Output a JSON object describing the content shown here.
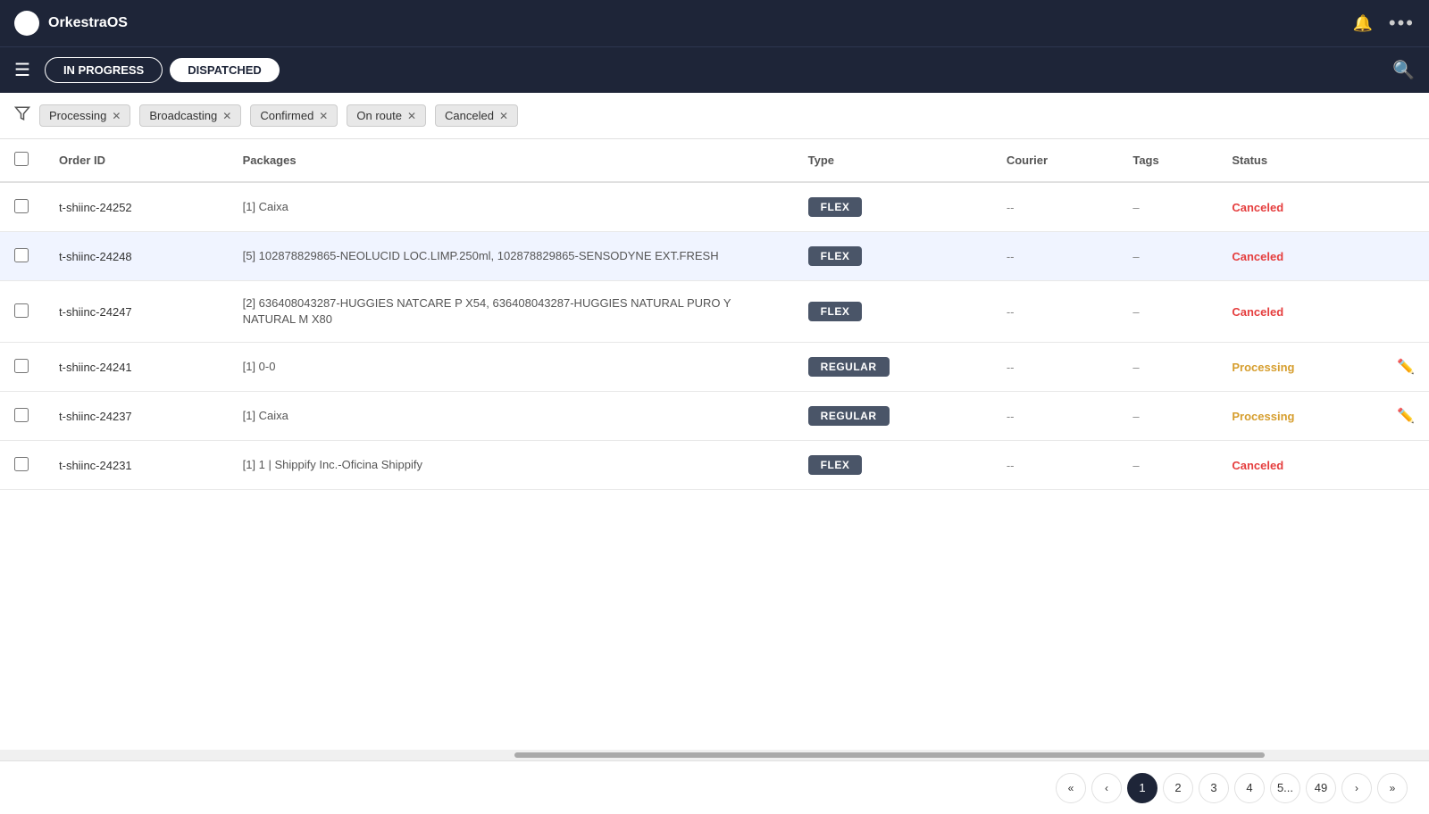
{
  "app": {
    "name": "OrkestraOS",
    "logo": "O"
  },
  "top_nav": {
    "bell_icon": "🔔",
    "more_icon": "···"
  },
  "sub_nav": {
    "tabs": [
      {
        "id": "in-progress",
        "label": "IN PROGRESS",
        "active": false
      },
      {
        "id": "dispatched",
        "label": "DISPATCHED",
        "active": true
      }
    ]
  },
  "filters": {
    "filter_icon": "▼",
    "tags": [
      {
        "id": "processing",
        "label": "Processing"
      },
      {
        "id": "broadcasting",
        "label": "Broadcasting"
      },
      {
        "id": "confirmed",
        "label": "Confirmed"
      },
      {
        "id": "on-route",
        "label": "On route"
      },
      {
        "id": "canceled",
        "label": "Canceled"
      }
    ]
  },
  "table": {
    "columns": [
      "Order ID",
      "Packages",
      "Type",
      "Courier",
      "Tags",
      "Status"
    ],
    "rows": [
      {
        "id": "t-shiinc-24252",
        "packages": "[1] Caixa",
        "type": "FLEX",
        "type_class": "flex",
        "courier": "--",
        "tags": "–",
        "status": "Canceled",
        "status_class": "status-canceled",
        "highlighted": false,
        "editable": false
      },
      {
        "id": "t-shiinc-24248",
        "packages": "[5] 102878829865-NEOLUCID LOC.LIMP.250ml, 102878829865-SENSODYNE EXT.FRESH",
        "type": "FLEX",
        "type_class": "flex",
        "courier": "--",
        "tags": "–",
        "status": "Canceled",
        "status_class": "status-canceled",
        "highlighted": true,
        "editable": false
      },
      {
        "id": "t-shiinc-24247",
        "packages": "[2] 636408043287-HUGGIES NATCARE P X54, 636408043287-HUGGIES NATURAL PURO Y NATURAL M X80",
        "type": "FLEX",
        "type_class": "flex",
        "courier": "--",
        "tags": "–",
        "status": "Canceled",
        "status_class": "status-canceled",
        "highlighted": false,
        "editable": false
      },
      {
        "id": "t-shiinc-24241",
        "packages": "[1] 0-0",
        "type": "REGULAR",
        "type_class": "regular",
        "courier": "--",
        "tags": "–",
        "status": "Processing",
        "status_class": "status-processing",
        "highlighted": false,
        "editable": true
      },
      {
        "id": "t-shiinc-24237",
        "packages": "[1] Caixa",
        "type": "REGULAR",
        "type_class": "regular",
        "courier": "--",
        "tags": "–",
        "status": "Processing",
        "status_class": "status-processing",
        "highlighted": false,
        "editable": true
      },
      {
        "id": "t-shiinc-24231",
        "packages": "[1] 1 | Shippify Inc.-Oficina Shippify",
        "type": "FLEX",
        "type_class": "flex",
        "courier": "--",
        "tags": "–",
        "status": "Canceled",
        "status_class": "status-canceled",
        "highlighted": false,
        "editable": false
      }
    ]
  },
  "pagination": {
    "first_label": "«",
    "prev_label": "‹",
    "next_label": "›",
    "last_label": "»",
    "pages": [
      "1",
      "2",
      "3",
      "4",
      "5...",
      "49"
    ],
    "active_page": "1"
  }
}
